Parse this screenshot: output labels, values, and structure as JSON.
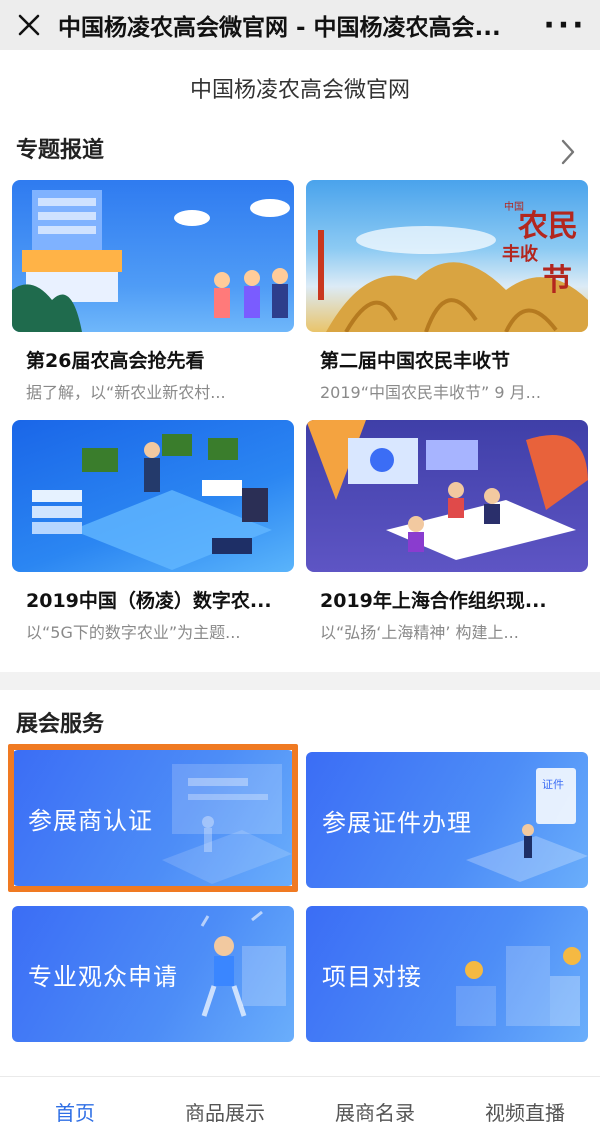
{
  "topbar": {
    "title": "中国杨凌农高会微官网 - 中国杨凌农高会...",
    "more_label": "···"
  },
  "site_title": "中国杨凌农高会微官网",
  "features": {
    "heading": "专题报道",
    "articles": [
      {
        "title": "第26届农高会抢先看",
        "desc": "据了解，以“新农业新农村..."
      },
      {
        "title": "第二届中国农民丰收节",
        "desc": "2019“中国农民丰收节” 9 月..."
      },
      {
        "title": "2019中国（杨凌）数字农...",
        "desc": "以“5G下的数字农业”为主题..."
      },
      {
        "title": "2019年上海合作组织现...",
        "desc": "以“弘扬‘上海精神’ 构建上..."
      }
    ],
    "harvest_badge_big": "农民",
    "harvest_badge_small": "丰收",
    "harvest_badge_last": "节",
    "harvest_badge_corner": "中国"
  },
  "services": {
    "heading": "展会服务",
    "tiles": [
      {
        "label": "参展商认证"
      },
      {
        "label": "参展证件办理"
      },
      {
        "label": "专业观众申请"
      },
      {
        "label": "项目对接"
      }
    ],
    "certificate_text": "证件"
  },
  "bottom_nav": {
    "items": [
      {
        "label": "首页",
        "active": true
      },
      {
        "label": "商品展示",
        "active": false
      },
      {
        "label": "展商名录",
        "active": false
      },
      {
        "label": "视频直播",
        "active": false
      }
    ]
  },
  "colors": {
    "accent": "#2f6fe5",
    "highlight": "#f07a22",
    "tile_blue": "#3b6df5"
  }
}
